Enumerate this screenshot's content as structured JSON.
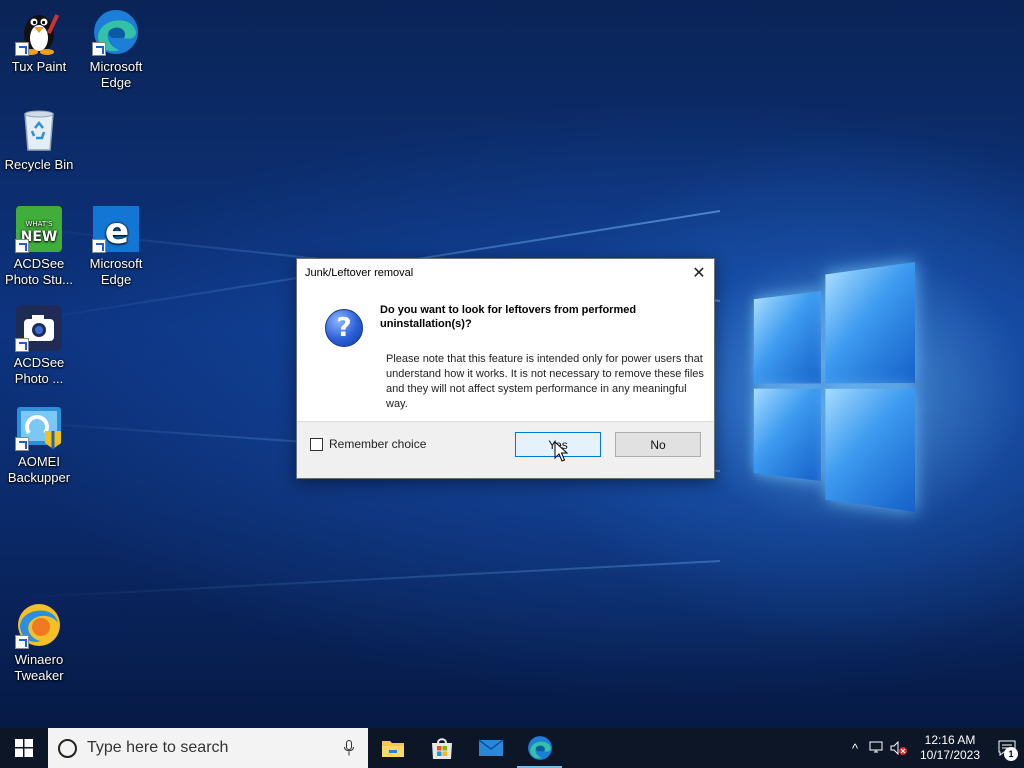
{
  "desktop": {
    "icons": [
      {
        "label": "Tux Paint",
        "icon": "tux-paint-icon"
      },
      {
        "label": "Microsoft Edge",
        "icon": "edge-chromium-icon"
      },
      {
        "label": "Recycle Bin",
        "icon": "recycle-bin-icon"
      },
      {
        "label": "ACDSee Photo Stu...",
        "icon": "acdsee-whats-new-icon"
      },
      {
        "label": "Microsoft Edge",
        "icon": "edge-legacy-icon"
      },
      {
        "label": "ACDSee Photo ...",
        "icon": "acdsee-camera-icon"
      },
      {
        "label": "AOMEI Backupper",
        "icon": "aomei-backupper-icon"
      },
      {
        "label": "Winaero Tweaker",
        "icon": "winaero-tweaker-icon"
      }
    ],
    "acdsee_badge_top": "WHAT'S",
    "acdsee_badge_bottom": "NEW"
  },
  "dialog": {
    "title": "Junk/Leftover removal",
    "close_glyph": "✕",
    "question_glyph": "?",
    "heading": "Do you want to look for leftovers from performed uninstallation(s)?",
    "body": "Please note that this feature is intended only for power users that understand how it works. It is not necessary to remove these files and they will not affect system performance in any meaningful way.",
    "remember_label": "Remember choice",
    "remember_checked": false,
    "yes_label": "Yes",
    "no_label": "No"
  },
  "taskbar": {
    "search_placeholder": "Type here to search",
    "apps": [
      "file-explorer-icon",
      "microsoft-store-icon",
      "mail-icon",
      "edge-icon"
    ],
    "tray": {
      "chevron": "^",
      "time": "12:16 AM",
      "date": "10/17/2023",
      "notification_count": "1"
    }
  },
  "colors": {
    "accent": "#0078d7",
    "taskbar": "#0d1626",
    "wallpaper": "#0b2a6a"
  }
}
